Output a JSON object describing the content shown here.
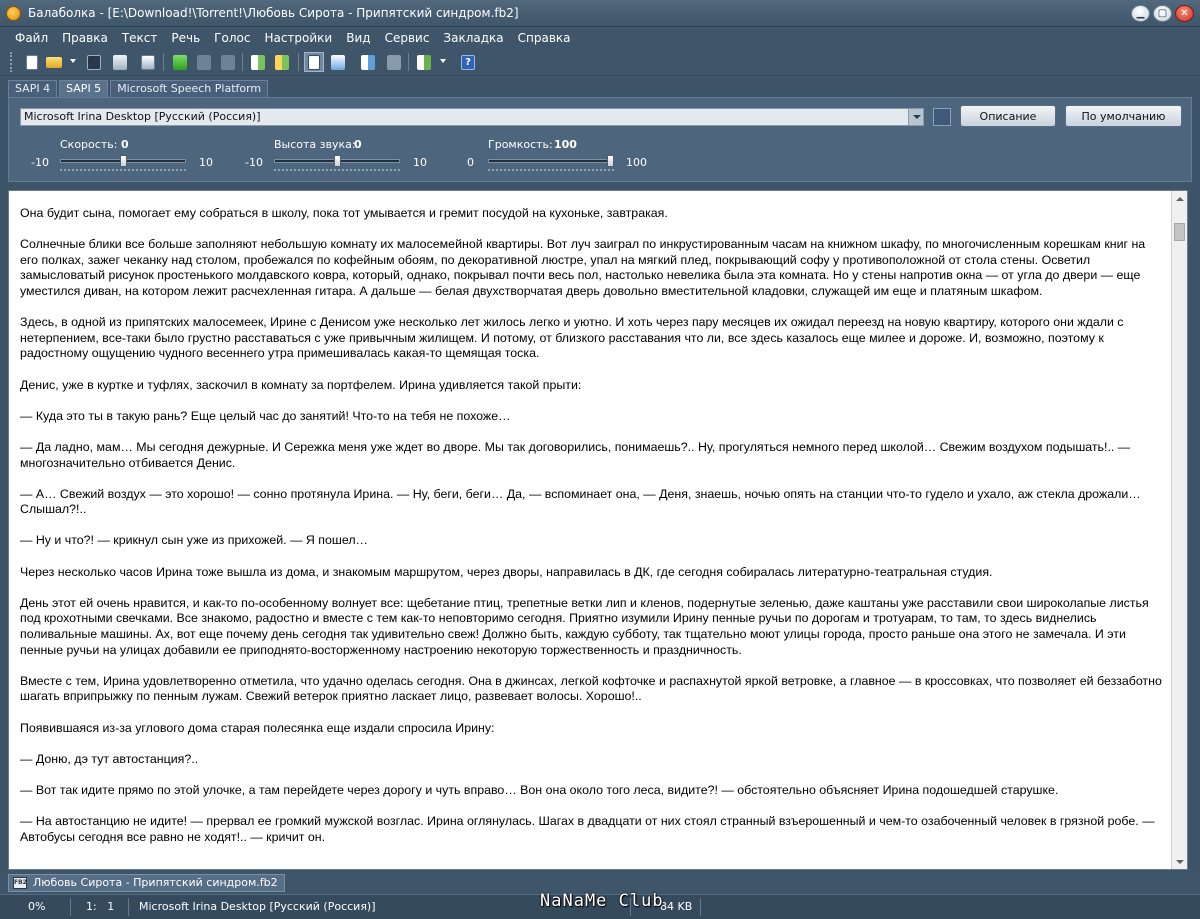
{
  "window": {
    "title": "Балаболка - [E:\\Download!\\Torrent!\\Любовь Сирота - Припятский синдром.fb2]",
    "minimize_glyph": "▁",
    "maximize_glyph": "▢",
    "close_glyph": "✕"
  },
  "menu": [
    "Файл",
    "Правка",
    "Текст",
    "Речь",
    "Голос",
    "Настройки",
    "Вид",
    "Сервис",
    "Закладка",
    "Справка"
  ],
  "toolbar": {
    "icons": [
      "new-file-icon",
      "open-folder-icon",
      "save-icon",
      "save-audio-icon",
      "convert-icon",
      "play-icon",
      "pause-icon",
      "stop-icon",
      "read-clipboard-icon",
      "read-file-icon",
      "text-view-icon",
      "audio-view-icon",
      "split-file-icon",
      "batch-icon",
      "dictionary-icon",
      "help-icon"
    ],
    "active": "text-view-icon",
    "help_glyph": "?"
  },
  "tabs": [
    {
      "label": "SAPI 4",
      "active": false
    },
    {
      "label": "SAPI 5",
      "active": true
    },
    {
      "label": "Microsoft Speech Platform",
      "active": false
    }
  ],
  "voice": {
    "selected": "Microsoft Irina Desktop [Русский (Россия)]",
    "description_button": "Описание",
    "default_button": "По умолчанию"
  },
  "sliders": {
    "speed": {
      "label": "Скорость:",
      "value": "0",
      "min": "-10",
      "max": "10",
      "level": 0.5
    },
    "pitch": {
      "label": "Высота звука:",
      "value": "0",
      "min": "-10",
      "max": "10",
      "level": 0.5
    },
    "volume": {
      "label": "Громкость:",
      "value": "100",
      "min": "0",
      "max": "100",
      "level": 1.0
    }
  },
  "document": {
    "paragraphs": [
      "Она будит сына, помогает ему собраться в школу, пока тот умывается и гремит посудой на кухоньке, завтракая.",
      "Солнечные блики все больше заполняют небольшую комнату их малосемейной квартиры. Вот луч заиграл по инкрустированным часам на книжном шкафу, по многочисленным корешкам книг на его полках, зажег чеканку над столом, пробежался по кофейным обоям, по декоративной люстре, упал на мягкий плед, покрывающий софу у противоположной от стола стены. Осветил замысловатый рисунок простенького молдавского ковра, который, однако, покрывал почти весь пол, настолько невелика была эта комната. Но у стены напротив окна — от угла до двери — еще уместился диван, на котором лежит расчехленная гитара. А дальше — белая двухстворчатая дверь довольно вместительной кладовки, служащей им еще и платяным шкафом.",
      "Здесь, в одной из припятских малосемеек, Ирине с Денисом уже несколько лет жилось легко и уютно. И хоть через пару месяцев их ожидал переезд на новую квартиру, которого они ждали с нетерпением, все-таки было грустно расставаться с уже привычным жилищем. И потому, от близкого расставания что ли, все здесь казалось еще милее и дороже. И, возможно, поэтому к радостному ощущению чудного весеннего утра примешивалась какая-то щемящая тоска.",
      "Денис, уже в куртке и туфлях, заскочил в комнату за портфелем. Ирина удивляется такой прыти:",
      "— Куда это ты в такую рань? Еще целый час до занятий! Что-то на тебя не похоже…",
      "— Да ладно, мам… Мы сегодня дежурные. И Сережка меня уже ждет во дворе. Мы так договорились, понимаешь?.. Ну, прогуляться немного перед школой… Свежим воздухом подышать!.. — многозначительно отбивается Денис.",
      "— А… Свежий воздух — это хорошо! — сонно протянула Ирина. — Ну, беги, беги… Да, — вспоминает она, — Деня, знаешь, ночью опять на станции что-то гудело и ухало, аж стекла дрожали… Слышал?!..",
      "— Ну и что?! — крикнул сын уже из прихожей. — Я пошел…",
      "Через несколько часов Ирина тоже вышла из дома, и знакомым маршрутом, через дворы, направилась в ДК, где сегодня собиралась литературно-театральная студия.",
      "День этот ей очень нравится, и как-то по-особенному волнует все: щебетание птиц, трепетные ветки лип и кленов, подернутые зеленью, даже каштаны уже расставили свои широколапые листья под крохотными свечками. Все знакомо, радостно и вместе с тем как-то неповторимо сегодня. Приятно изумили Ирину пенные ручьи по дорогам и тротуарам, то там, то здесь виднелись поливальные машины. Ах, вот еще почему день сегодня так удивительно свеж! Должно быть, каждую субботу, так тщательно моют улицы города, просто раньше она этого не замечала. И эти пенные ручьи на улицах добавили ее приподнято-восторженному настроению некоторую торжественность и праздничность.",
      "Вместе с тем, Ирина удовлетворенно отметила, что удачно оделась сегодня. Она в джинсах, легкой кофточке и распахнутой яркой ветровке, а главное — в кроссовках, что позволяет ей беззаботно шагать вприпрыжку по пенным лужам. Свежий ветерок приятно ласкает лицо, развевает волосы. Хорошо!..",
      "Появившаяся из-за углового дома старая полесянка еще издали спросила Ирину:",
      "— Доню, дэ тут автостанция?..",
      "— Вот так идите прямо по этой улочке, а там перейдете через дорогу и чуть вправо… Вон она около того леса, видите?! — обстоятельно объясняет Ирина подошедшей старушке.",
      "— На автостанцию не идите! — прервал ее громкий мужской возглас. Ирина оглянулась. Шагах в двадцати от них стоял странный взъерошенный и чем-то озабоченный человек в грязной робе. — Автобусы сегодня все равно не ходят!.. — кричит он."
    ]
  },
  "doc_tab": {
    "label": "Любовь Сирота - Припятский синдром.fb2",
    "icon_text": "FB2"
  },
  "status": {
    "progress": "0%",
    "position": "1:   1",
    "voice": "Microsoft Irina Desktop [Русский (Россия)]",
    "size": "84 KB"
  },
  "watermark": "NaNaMe Club"
}
